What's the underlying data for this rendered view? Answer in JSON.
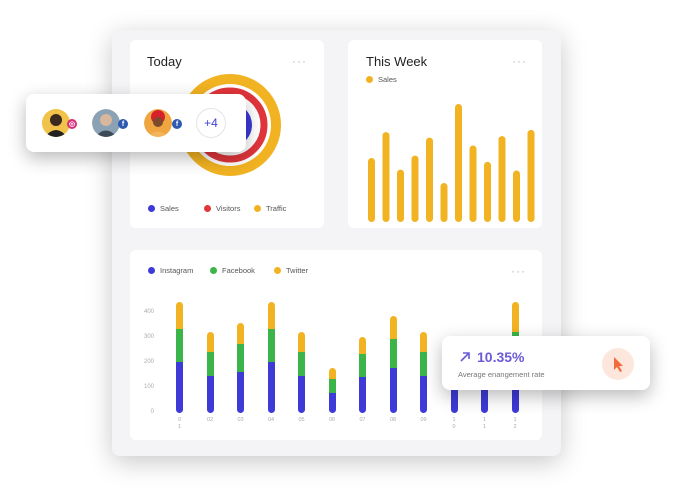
{
  "today": {
    "title": "Today",
    "more": "···",
    "legend": [
      {
        "label": "Sales",
        "color": "#3d3ad8"
      },
      {
        "label": "Visitors",
        "color": "#e0353b"
      },
      {
        "label": "Traffic",
        "color": "#f2b322"
      }
    ]
  },
  "week": {
    "title": "This Week",
    "more": "···",
    "legend_label": "Sales",
    "color": "#f2b322"
  },
  "engagement": {
    "more": "···",
    "legend": [
      {
        "label": "Instagram",
        "color": "#3d3ad8"
      },
      {
        "label": "Facebook",
        "color": "#3bb54a"
      },
      {
        "label": "Twitter",
        "color": "#f2b322"
      }
    ]
  },
  "social_card": {
    "avatars": [
      {
        "name": "avatar-1",
        "badge": "instagram"
      },
      {
        "name": "avatar-2",
        "badge": "facebook"
      },
      {
        "name": "avatar-3",
        "badge": "facebook"
      }
    ],
    "extra_count": "+4"
  },
  "rate_card": {
    "value": "10.35%",
    "label": "Average enangement rate",
    "accent": "#6b5bd6",
    "icon_bg": "#fde7dc",
    "icon_color": "#f36b3b"
  },
  "chart_data": [
    {
      "type": "pie",
      "title": "Today",
      "series": [
        {
          "name": "Sales"
        },
        {
          "name": "Visitors"
        },
        {
          "name": "Traffic"
        }
      ]
    },
    {
      "type": "bar",
      "title": "This Week",
      "series": [
        {
          "name": "Sales",
          "values": [
            82,
            115,
            67,
            85,
            108,
            50,
            151,
            98,
            77,
            110,
            66,
            118
          ]
        }
      ],
      "ylim": [
        0,
        160
      ]
    },
    {
      "type": "bar",
      "stacked": true,
      "yticks": [
        "0",
        "100",
        "200",
        "300",
        "400"
      ],
      "ylim": [
        0,
        400
      ],
      "categories": [
        "0\n1",
        "02",
        "03",
        "04",
        "05",
        "06",
        "07",
        "08",
        "09",
        "1\n0",
        "1\n1",
        "1\n2"
      ],
      "series": [
        {
          "name": "Instagram",
          "values": [
            205,
            150,
            165,
            205,
            150,
            82,
            145,
            180,
            150,
            130,
            115,
            160
          ]
        },
        {
          "name": "Facebook",
          "values": [
            130,
            95,
            110,
            130,
            95,
            55,
            90,
            115,
            95,
            70,
            40,
            165
          ]
        },
        {
          "name": "Twitter",
          "values": [
            110,
            80,
            85,
            110,
            80,
            45,
            70,
            95,
            80,
            80,
            45,
            120
          ]
        }
      ]
    }
  ]
}
